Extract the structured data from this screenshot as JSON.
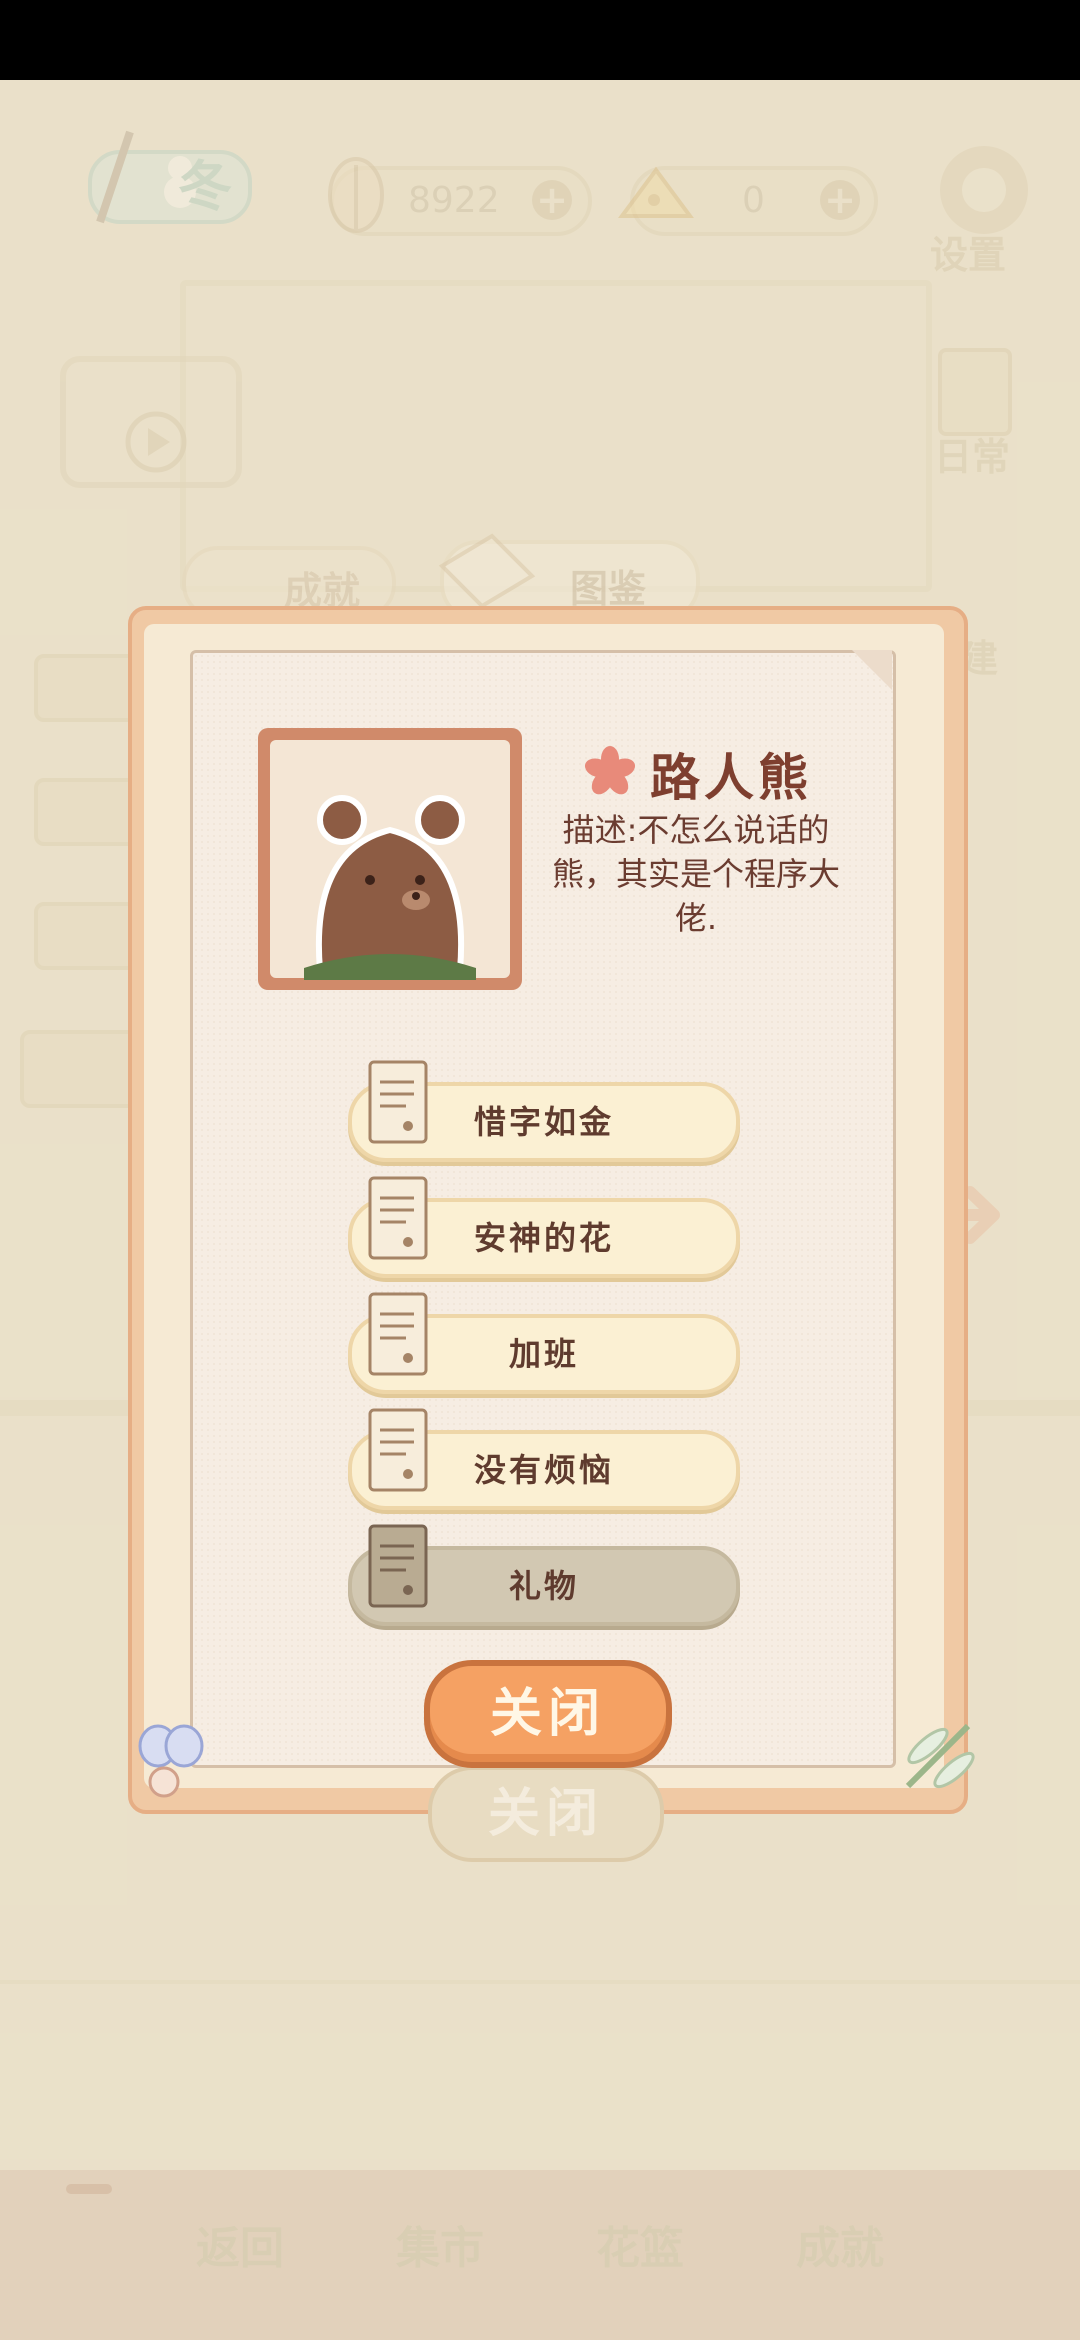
{
  "hud": {
    "season_label": "冬",
    "fish_count": "8922",
    "cheese_count": "0",
    "settings_label": "设置"
  },
  "side_menu": {
    "daily_label": "日常",
    "build_label": "建"
  },
  "tabs": {
    "achievements_label": "成就",
    "collection_label": "图鉴"
  },
  "character": {
    "name": "路人熊",
    "description": "描述:不怎么说话的熊，其实是个程序大佬."
  },
  "stories": [
    {
      "label": "惜字如金",
      "locked": false
    },
    {
      "label": "安神的花",
      "locked": false
    },
    {
      "label": "加班",
      "locked": false
    },
    {
      "label": "没有烦恼",
      "locked": false
    },
    {
      "label": "礼物",
      "locked": true
    }
  ],
  "dialog": {
    "close_label": "关闭",
    "close_ghost_label": "关闭"
  },
  "bottom_nav": [
    {
      "label": "返回"
    },
    {
      "label": "集市"
    },
    {
      "label": "花篮"
    },
    {
      "label": "成就"
    }
  ],
  "colors": {
    "accent_orange": "#f5a163",
    "frame_peach": "#f0c9a4",
    "name_brown": "#7e3f2f"
  }
}
